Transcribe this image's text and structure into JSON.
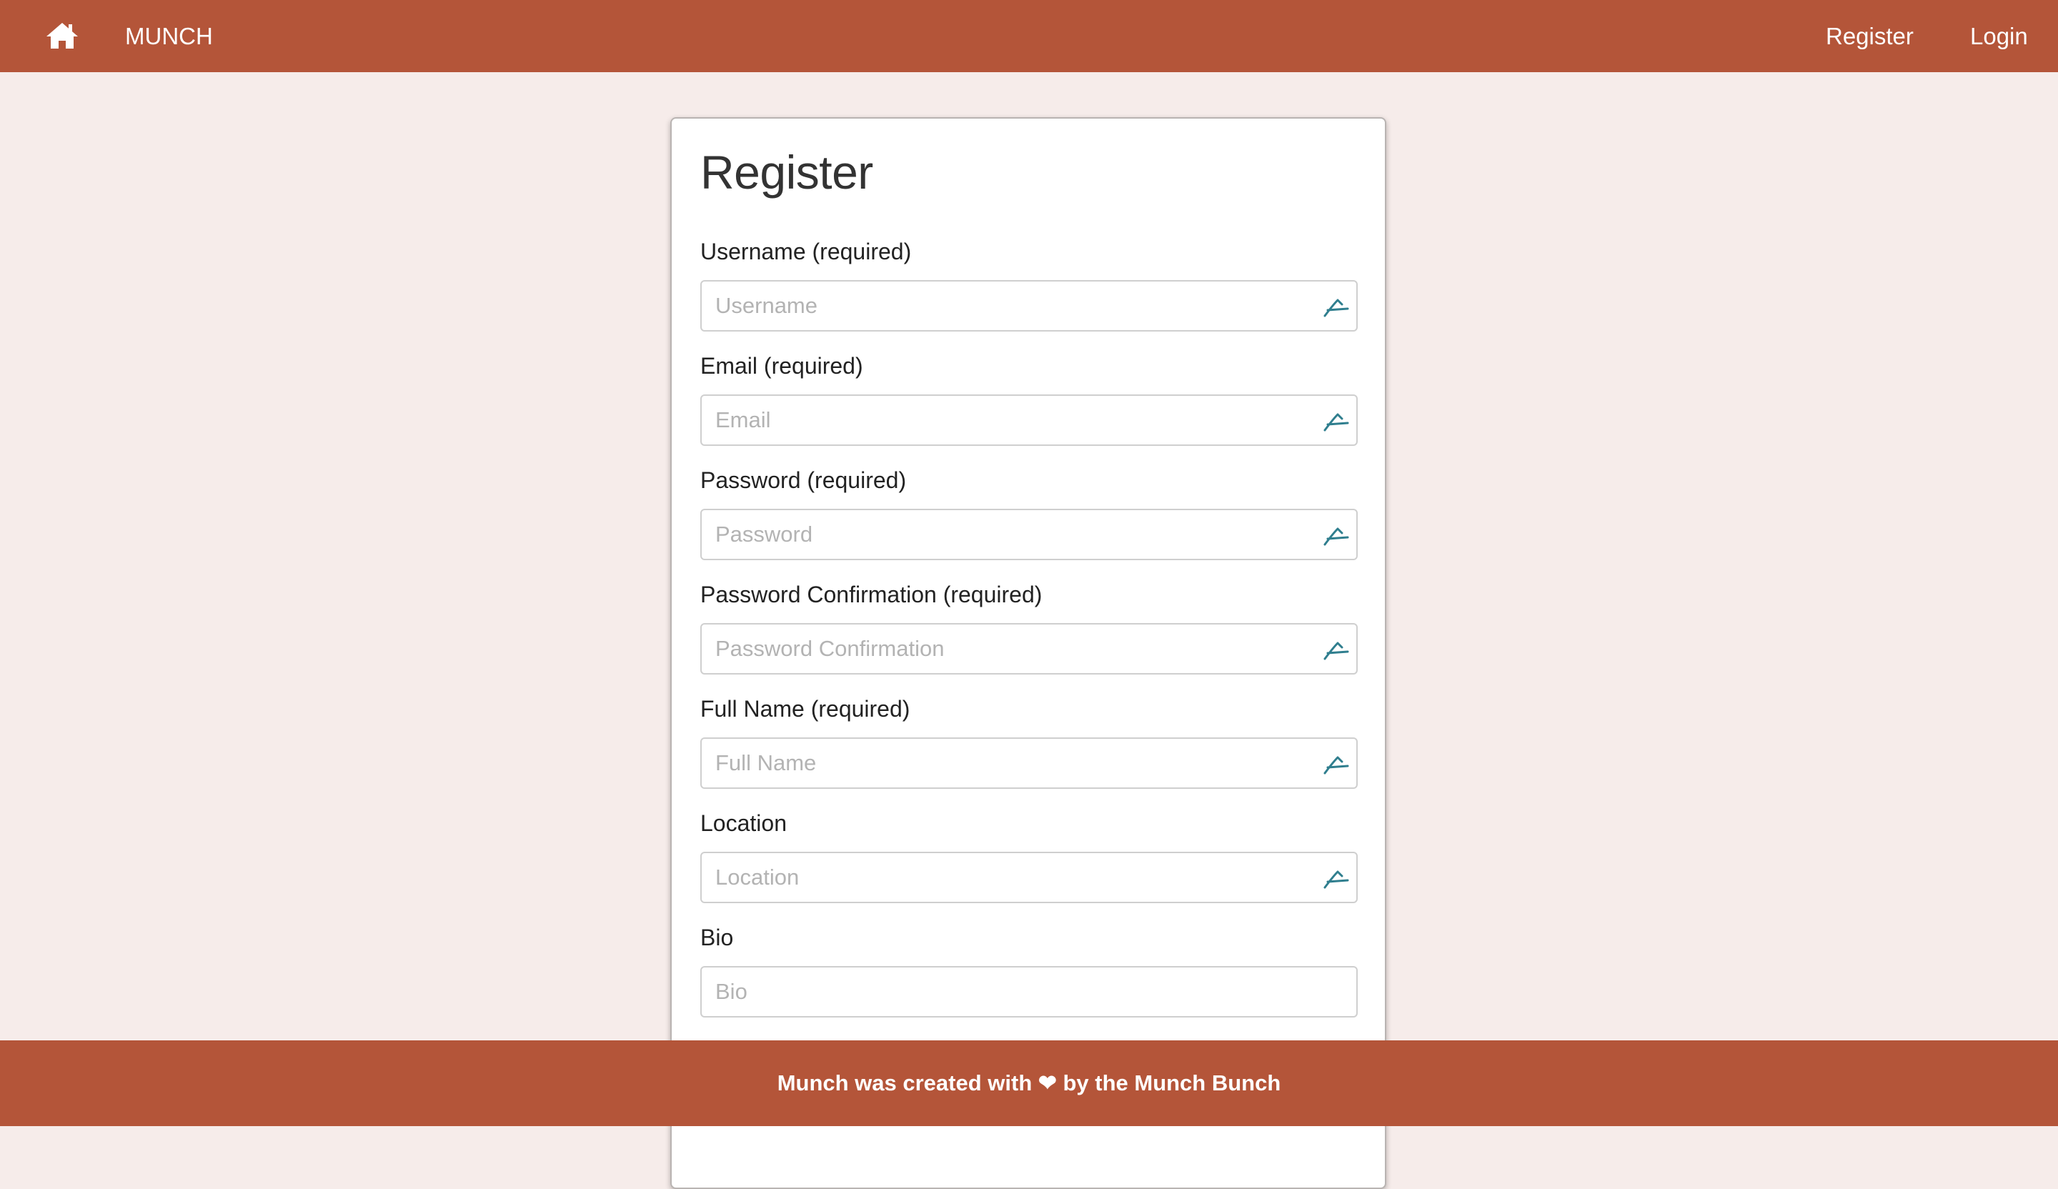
{
  "nav": {
    "home_icon": "home-icon",
    "brand": "MUNCH",
    "register": "Register",
    "login": "Login"
  },
  "form": {
    "title": "Register",
    "fields": [
      {
        "label": "Username (required)",
        "placeholder": "Username",
        "icon": "autofill-key-icon"
      },
      {
        "label": "Email (required)",
        "placeholder": "Email",
        "icon": "autofill-key-icon"
      },
      {
        "label": "Password (required)",
        "placeholder": "Password",
        "icon": "autofill-key-icon"
      },
      {
        "label": "Password Confirmation (required)",
        "placeholder": "Password Confirmation",
        "icon": "autofill-key-icon"
      },
      {
        "label": "Full Name (required)",
        "placeholder": "Full Name",
        "icon": "autofill-key-icon"
      },
      {
        "label": "Location",
        "placeholder": "Location",
        "icon": "autofill-key-icon"
      },
      {
        "label": "Bio",
        "placeholder": "Bio"
      }
    ]
  },
  "footer": {
    "text": "Munch was created with ❤ by the Munch Bunch"
  },
  "colors": {
    "brand": "#b45539",
    "background": "#f6ecea",
    "icon": "#2f7e8e"
  }
}
